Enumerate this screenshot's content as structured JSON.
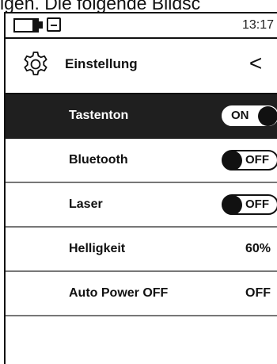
{
  "caption_text": "igen. Die folgende Bildsc",
  "status_bar": {
    "time": "13:17"
  },
  "header": {
    "title": "Einstellung",
    "back_symbol": "<"
  },
  "settings": [
    {
      "label": "Tastenton",
      "type": "toggle",
      "value": "ON",
      "selected": true
    },
    {
      "label": "Bluetooth",
      "type": "toggle",
      "value": "OFF",
      "selected": false
    },
    {
      "label": "Laser",
      "type": "toggle",
      "value": "OFF",
      "selected": false
    },
    {
      "label": "Helligkeit",
      "type": "value",
      "value": "60%",
      "selected": false
    },
    {
      "label": "Auto Power OFF",
      "type": "value",
      "value": "OFF",
      "selected": false
    }
  ],
  "icons": {
    "battery": "battery-icon",
    "save": "save-icon",
    "settings": "gear-icon",
    "back": "chevron-left-icon"
  },
  "colors": {
    "selected_row_bg": "#1f1f1f",
    "background": "#ffffff",
    "foreground": "#111111"
  }
}
